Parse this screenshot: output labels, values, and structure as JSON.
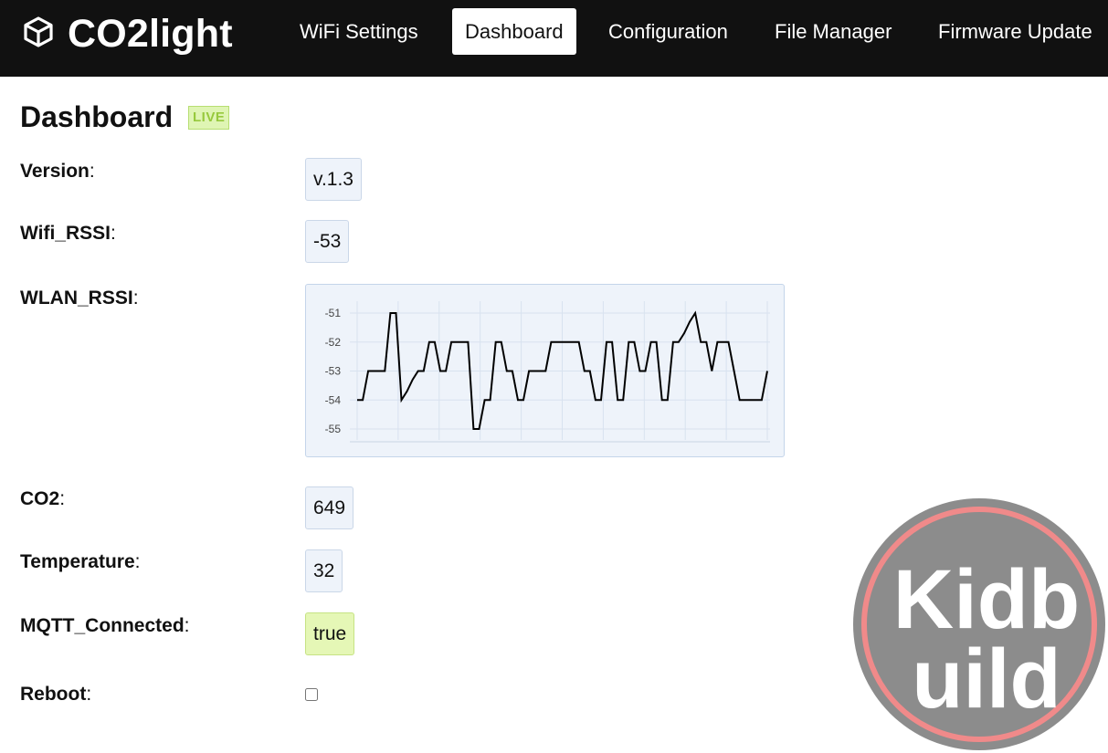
{
  "header": {
    "app_title": "CO2light",
    "nav": [
      {
        "label": "WiFi Settings",
        "active": false
      },
      {
        "label": "Dashboard",
        "active": true
      },
      {
        "label": "Configuration",
        "active": false
      },
      {
        "label": "File Manager",
        "active": false
      },
      {
        "label": "Firmware Update",
        "active": false
      }
    ]
  },
  "page": {
    "title": "Dashboard",
    "badge": "LIVE"
  },
  "fields": {
    "version": {
      "label": "Version",
      "value": "v.1.3"
    },
    "wifi_rssi": {
      "label": "Wifi_RSSI",
      "value": "-53"
    },
    "wlan_rssi": {
      "label": "WLAN_RSSI"
    },
    "co2": {
      "label": "CO2",
      "value": "649"
    },
    "temperature": {
      "label": "Temperature",
      "value": "32"
    },
    "mqtt_connected": {
      "label": "MQTT_Connected",
      "value": "true"
    },
    "reboot": {
      "label": "Reboot",
      "checked": false
    }
  },
  "label_suffix": ":",
  "watermark": {
    "text_top": "Kidb",
    "text_bottom": "uild"
  },
  "colors": {
    "topbar": "#111111",
    "value_bg": "#eef3fa",
    "ok_bg": "#e5f7b6",
    "live_text": "#97c93d",
    "line": "#000000"
  },
  "chart_data": {
    "type": "line",
    "title": "",
    "xlabel": "",
    "ylabel": "",
    "ylim": [
      -55,
      -51
    ],
    "y_ticks": [
      -51,
      -52,
      -53,
      -54,
      -55
    ],
    "grid": true,
    "values": [
      -54,
      -54,
      -53,
      -53,
      -53,
      -53,
      -51,
      -51,
      -54,
      -53.7,
      -53.3,
      -53,
      -53,
      -52,
      -52,
      -53,
      -53,
      -52,
      -52,
      -52,
      -52,
      -55,
      -55,
      -54,
      -54,
      -52,
      -52,
      -53,
      -53,
      -54,
      -54,
      -53,
      -53,
      -53,
      -53,
      -52,
      -52,
      -52,
      -52,
      -52,
      -52,
      -53,
      -53,
      -54,
      -54,
      -52,
      -52,
      -54,
      -54,
      -52,
      -52,
      -53,
      -53,
      -52,
      -52,
      -54,
      -54,
      -52,
      -52,
      -51.7,
      -51.3,
      -51,
      -52,
      -52,
      -53,
      -52,
      -52,
      -52,
      -53,
      -54,
      -54,
      -54,
      -54,
      -54,
      -53
    ]
  }
}
